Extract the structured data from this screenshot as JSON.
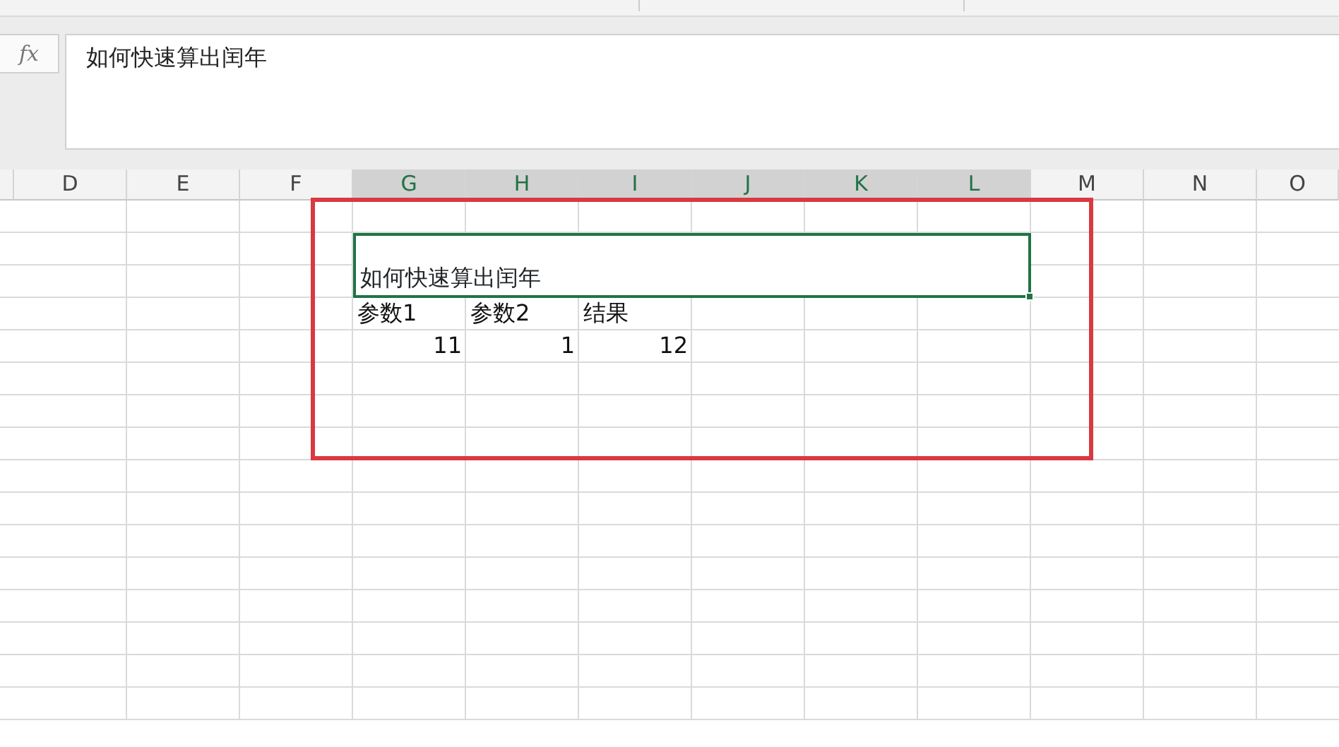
{
  "formula_bar": {
    "fx_label": "fx",
    "formula": "如何快速算出闰年"
  },
  "columns": [
    {
      "label": "D",
      "selected": false
    },
    {
      "label": "E",
      "selected": false
    },
    {
      "label": "F",
      "selected": false
    },
    {
      "label": "G",
      "selected": true
    },
    {
      "label": "H",
      "selected": true
    },
    {
      "label": "I",
      "selected": true
    },
    {
      "label": "J",
      "selected": true
    },
    {
      "label": "K",
      "selected": true
    },
    {
      "label": "L",
      "selected": true
    },
    {
      "label": "M",
      "selected": false
    },
    {
      "label": "N",
      "selected": false
    },
    {
      "label": "O",
      "selected": false
    }
  ],
  "merged_cell": {
    "text": "如何快速算出闰年",
    "selected": true
  },
  "rows": [
    {
      "kind": "text",
      "cells": [
        "参数1",
        "参数2",
        "结果"
      ]
    },
    {
      "kind": "number",
      "cells": [
        "11",
        "1",
        "12"
      ]
    }
  ],
  "annotation": {
    "color": "#d9393f"
  }
}
